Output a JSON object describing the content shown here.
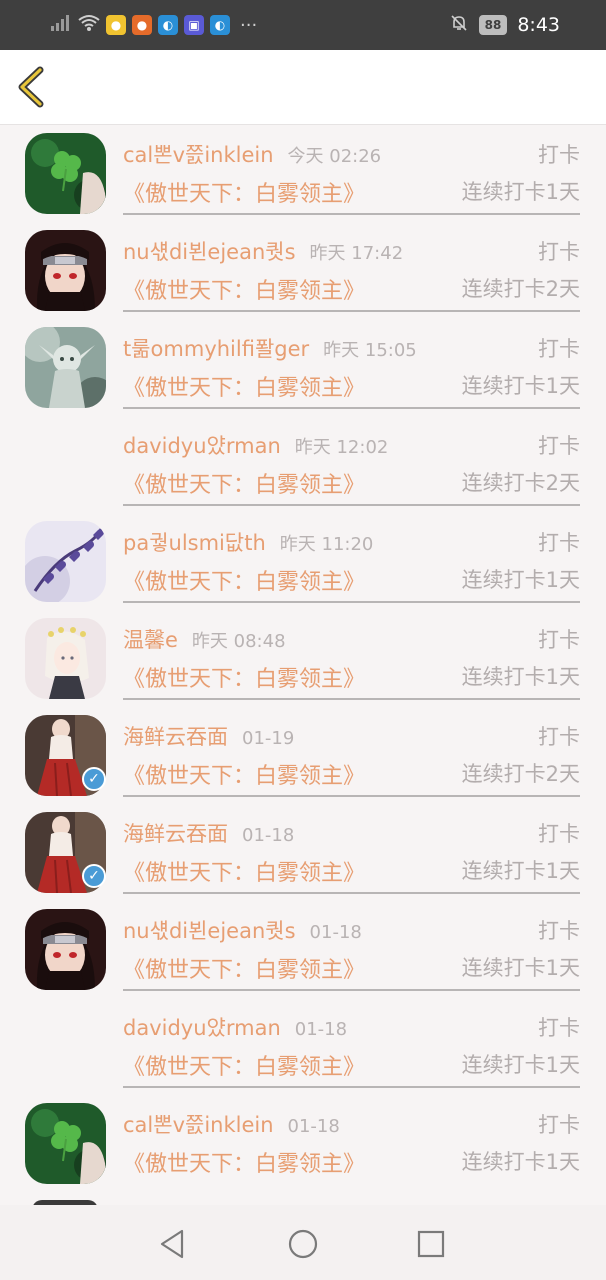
{
  "status_bar": {
    "time": "8:43",
    "battery": "88",
    "more": "···",
    "signal": "×∙∙∙"
  },
  "header": {
    "back_icon": "chevron-left-icon"
  },
  "rows": [
    {
      "name": "cal뽄v쯠inklein",
      "time": "今天 02:26",
      "action": "打卡",
      "book": "《傲世天下：白雾领主》",
      "streak": "连续打卡1天",
      "avatar": "clover"
    },
    {
      "name": "nu섃di뵌ejean퀏s",
      "time": "昨天 17:42",
      "action": "打卡",
      "book": "《傲世天下：白雾领主》",
      "streak": "连续打卡2天",
      "avatar": "ninja"
    },
    {
      "name": "t룲ommyhilfi퐐ger",
      "time": "昨天 15:05",
      "action": "打卡",
      "book": "《傲世天下：白雾领主》",
      "streak": "连续打卡1天",
      "avatar": "elf"
    },
    {
      "name": "davidyu얐rman",
      "time": "昨天 12:02",
      "action": "打卡",
      "book": "《傲世天下：白雾领主》",
      "streak": "连续打卡2天",
      "avatar": "none"
    },
    {
      "name": "pa궣ulsmi닶th",
      "time": "昨天 11:20",
      "action": "打卡",
      "book": "《傲世天下：白雾领主》",
      "streak": "连续打卡1天",
      "avatar": "hearts"
    },
    {
      "name": "温馨e",
      "time": "昨天 08:48",
      "action": "打卡",
      "book": "《傲世天下：白雾领主》",
      "streak": "连续打卡1天",
      "avatar": "girl"
    },
    {
      "name": "海鲜云吞面",
      "time": "01-19",
      "action": "打卡",
      "book": "《傲世天下：白雾领主》",
      "streak": "连续打卡2天",
      "avatar": "red",
      "verified": "✓"
    },
    {
      "name": "海鲜云吞面",
      "time": "01-18",
      "action": "打卡",
      "book": "《傲世天下：白雾领主》",
      "streak": "连续打卡1天",
      "avatar": "red",
      "verified": "✓"
    },
    {
      "name": "nu섃di뵌ejean퀏s",
      "time": "01-18",
      "action": "打卡",
      "book": "《傲世天下：白雾领主》",
      "streak": "连续打卡1天",
      "avatar": "ninja"
    },
    {
      "name": "davidyu얐rman",
      "time": "01-18",
      "action": "打卡",
      "book": "《傲世天下：白雾领主》",
      "streak": "连续打卡1天",
      "avatar": "none"
    },
    {
      "name": "cal뽄v쯠inklein",
      "time": "01-18",
      "action": "打卡",
      "book": "《傲世天下：白雾领主》",
      "streak": "连续打卡1天",
      "avatar": "clover"
    }
  ],
  "nav": {
    "back": "triangle-back-icon",
    "home": "circle-home-icon",
    "recent": "square-recent-icon"
  },
  "colors": {
    "accent": "#e79e72",
    "muted": "#b3adad",
    "status_bg": "#3f3f3f"
  }
}
